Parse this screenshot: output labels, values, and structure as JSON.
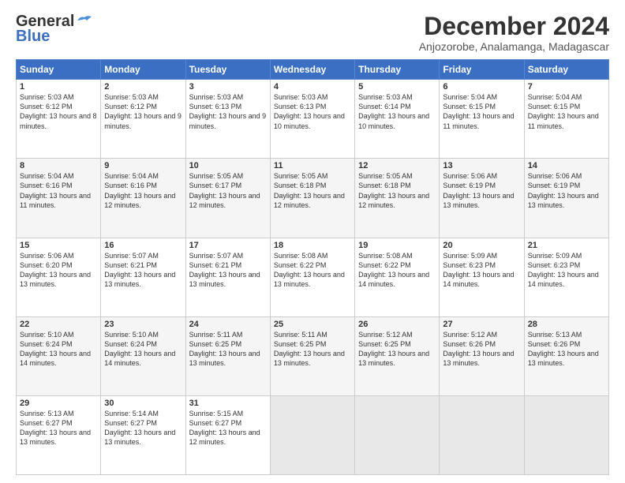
{
  "header": {
    "logo_general": "General",
    "logo_blue": "Blue",
    "main_title": "December 2024",
    "subtitle": "Anjozorobe, Analamanga, Madagascar"
  },
  "calendar": {
    "days_of_week": [
      "Sunday",
      "Monday",
      "Tuesday",
      "Wednesday",
      "Thursday",
      "Friday",
      "Saturday"
    ],
    "weeks": [
      [
        {
          "day": "1",
          "sunrise": "Sunrise: 5:03 AM",
          "sunset": "Sunset: 6:12 PM",
          "daylight": "Daylight: 13 hours and 8 minutes."
        },
        {
          "day": "2",
          "sunrise": "Sunrise: 5:03 AM",
          "sunset": "Sunset: 6:12 PM",
          "daylight": "Daylight: 13 hours and 9 minutes."
        },
        {
          "day": "3",
          "sunrise": "Sunrise: 5:03 AM",
          "sunset": "Sunset: 6:13 PM",
          "daylight": "Daylight: 13 hours and 9 minutes."
        },
        {
          "day": "4",
          "sunrise": "Sunrise: 5:03 AM",
          "sunset": "Sunset: 6:13 PM",
          "daylight": "Daylight: 13 hours and 10 minutes."
        },
        {
          "day": "5",
          "sunrise": "Sunrise: 5:03 AM",
          "sunset": "Sunset: 6:14 PM",
          "daylight": "Daylight: 13 hours and 10 minutes."
        },
        {
          "day": "6",
          "sunrise": "Sunrise: 5:04 AM",
          "sunset": "Sunset: 6:15 PM",
          "daylight": "Daylight: 13 hours and 11 minutes."
        },
        {
          "day": "7",
          "sunrise": "Sunrise: 5:04 AM",
          "sunset": "Sunset: 6:15 PM",
          "daylight": "Daylight: 13 hours and 11 minutes."
        }
      ],
      [
        {
          "day": "8",
          "sunrise": "Sunrise: 5:04 AM",
          "sunset": "Sunset: 6:16 PM",
          "daylight": "Daylight: 13 hours and 11 minutes."
        },
        {
          "day": "9",
          "sunrise": "Sunrise: 5:04 AM",
          "sunset": "Sunset: 6:16 PM",
          "daylight": "Daylight: 13 hours and 12 minutes."
        },
        {
          "day": "10",
          "sunrise": "Sunrise: 5:05 AM",
          "sunset": "Sunset: 6:17 PM",
          "daylight": "Daylight: 13 hours and 12 minutes."
        },
        {
          "day": "11",
          "sunrise": "Sunrise: 5:05 AM",
          "sunset": "Sunset: 6:18 PM",
          "daylight": "Daylight: 13 hours and 12 minutes."
        },
        {
          "day": "12",
          "sunrise": "Sunrise: 5:05 AM",
          "sunset": "Sunset: 6:18 PM",
          "daylight": "Daylight: 13 hours and 12 minutes."
        },
        {
          "day": "13",
          "sunrise": "Sunrise: 5:06 AM",
          "sunset": "Sunset: 6:19 PM",
          "daylight": "Daylight: 13 hours and 13 minutes."
        },
        {
          "day": "14",
          "sunrise": "Sunrise: 5:06 AM",
          "sunset": "Sunset: 6:19 PM",
          "daylight": "Daylight: 13 hours and 13 minutes."
        }
      ],
      [
        {
          "day": "15",
          "sunrise": "Sunrise: 5:06 AM",
          "sunset": "Sunset: 6:20 PM",
          "daylight": "Daylight: 13 hours and 13 minutes."
        },
        {
          "day": "16",
          "sunrise": "Sunrise: 5:07 AM",
          "sunset": "Sunset: 6:21 PM",
          "daylight": "Daylight: 13 hours and 13 minutes."
        },
        {
          "day": "17",
          "sunrise": "Sunrise: 5:07 AM",
          "sunset": "Sunset: 6:21 PM",
          "daylight": "Daylight: 13 hours and 13 minutes."
        },
        {
          "day": "18",
          "sunrise": "Sunrise: 5:08 AM",
          "sunset": "Sunset: 6:22 PM",
          "daylight": "Daylight: 13 hours and 13 minutes."
        },
        {
          "day": "19",
          "sunrise": "Sunrise: 5:08 AM",
          "sunset": "Sunset: 6:22 PM",
          "daylight": "Daylight: 13 hours and 14 minutes."
        },
        {
          "day": "20",
          "sunrise": "Sunrise: 5:09 AM",
          "sunset": "Sunset: 6:23 PM",
          "daylight": "Daylight: 13 hours and 14 minutes."
        },
        {
          "day": "21",
          "sunrise": "Sunrise: 5:09 AM",
          "sunset": "Sunset: 6:23 PM",
          "daylight": "Daylight: 13 hours and 14 minutes."
        }
      ],
      [
        {
          "day": "22",
          "sunrise": "Sunrise: 5:10 AM",
          "sunset": "Sunset: 6:24 PM",
          "daylight": "Daylight: 13 hours and 14 minutes."
        },
        {
          "day": "23",
          "sunrise": "Sunrise: 5:10 AM",
          "sunset": "Sunset: 6:24 PM",
          "daylight": "Daylight: 13 hours and 14 minutes."
        },
        {
          "day": "24",
          "sunrise": "Sunrise: 5:11 AM",
          "sunset": "Sunset: 6:25 PM",
          "daylight": "Daylight: 13 hours and 13 minutes."
        },
        {
          "day": "25",
          "sunrise": "Sunrise: 5:11 AM",
          "sunset": "Sunset: 6:25 PM",
          "daylight": "Daylight: 13 hours and 13 minutes."
        },
        {
          "day": "26",
          "sunrise": "Sunrise: 5:12 AM",
          "sunset": "Sunset: 6:25 PM",
          "daylight": "Daylight: 13 hours and 13 minutes."
        },
        {
          "day": "27",
          "sunrise": "Sunrise: 5:12 AM",
          "sunset": "Sunset: 6:26 PM",
          "daylight": "Daylight: 13 hours and 13 minutes."
        },
        {
          "day": "28",
          "sunrise": "Sunrise: 5:13 AM",
          "sunset": "Sunset: 6:26 PM",
          "daylight": "Daylight: 13 hours and 13 minutes."
        }
      ],
      [
        {
          "day": "29",
          "sunrise": "Sunrise: 5:13 AM",
          "sunset": "Sunset: 6:27 PM",
          "daylight": "Daylight: 13 hours and 13 minutes."
        },
        {
          "day": "30",
          "sunrise": "Sunrise: 5:14 AM",
          "sunset": "Sunset: 6:27 PM",
          "daylight": "Daylight: 13 hours and 13 minutes."
        },
        {
          "day": "31",
          "sunrise": "Sunrise: 5:15 AM",
          "sunset": "Sunset: 6:27 PM",
          "daylight": "Daylight: 13 hours and 12 minutes."
        },
        null,
        null,
        null,
        null
      ]
    ]
  }
}
